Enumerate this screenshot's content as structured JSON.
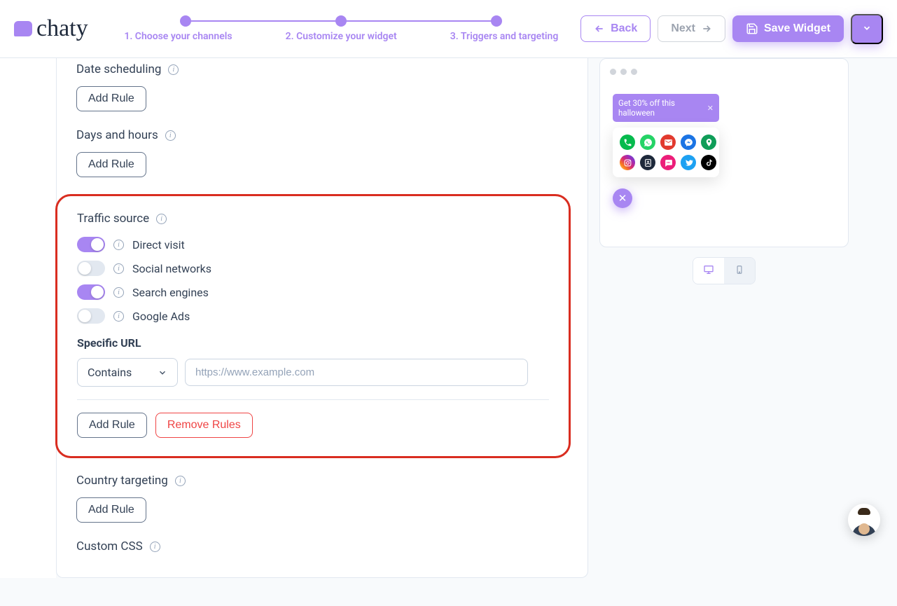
{
  "logo": {
    "text": "chaty"
  },
  "steps": {
    "items": [
      "1. Choose your channels",
      "2. Customize your widget",
      "3. Triggers and targeting"
    ]
  },
  "topActions": {
    "back": "Back",
    "next": "Next",
    "save": "Save Widget"
  },
  "sections": {
    "dateScheduling": {
      "title": "Date scheduling",
      "addRule": "Add Rule"
    },
    "daysHours": {
      "title": "Days and hours",
      "addRule": "Add Rule"
    },
    "trafficSource": {
      "title": "Traffic source",
      "toggles": {
        "directVisit": {
          "label": "Direct visit",
          "on": true
        },
        "socialNetworks": {
          "label": "Social networks",
          "on": false
        },
        "searchEngines": {
          "label": "Search engines",
          "on": true
        },
        "googleAds": {
          "label": "Google Ads",
          "on": false
        }
      },
      "specificUrl": {
        "label": "Specific URL",
        "select": "Contains",
        "placeholder": "https://www.example.com"
      },
      "addRule": "Add Rule",
      "removeRules": "Remove Rules"
    },
    "countryTargeting": {
      "title": "Country targeting",
      "addRule": "Add Rule"
    },
    "customCss": {
      "title": "Custom CSS"
    }
  },
  "preview": {
    "cta": "Get 30% off this halloween",
    "channels": [
      {
        "name": "phone",
        "color": "#06ba4d"
      },
      {
        "name": "whatsapp",
        "color": "#25d366"
      },
      {
        "name": "email",
        "color": "#e23a2e"
      },
      {
        "name": "messenger",
        "color": "#1b74e4"
      },
      {
        "name": "maps",
        "color": "#0f9d58"
      },
      {
        "name": "instagram",
        "color": "linear-gradient(45deg,#feda75,#fa7e1e,#d62976,#962fbf,#4f5bd5)"
      },
      {
        "name": "contact-form",
        "color": "#1e293b"
      },
      {
        "name": "sms",
        "color": "#ec1e79"
      },
      {
        "name": "twitter",
        "color": "#1da1f2"
      },
      {
        "name": "tiktok",
        "color": "#000000"
      }
    ]
  }
}
